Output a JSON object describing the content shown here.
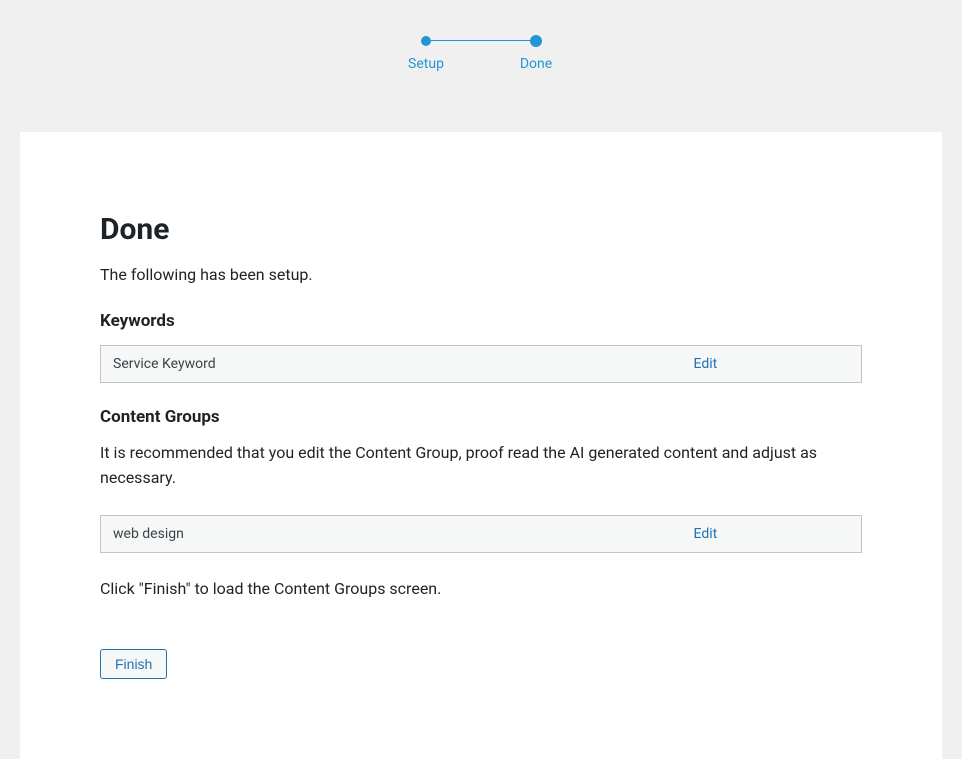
{
  "stepper": {
    "steps": [
      {
        "label": "Setup"
      },
      {
        "label": "Done"
      }
    ]
  },
  "page": {
    "title": "Done",
    "subtext": "The following has been setup."
  },
  "keywords": {
    "heading": "Keywords",
    "rows": [
      {
        "name": "Service Keyword",
        "edit_label": "Edit"
      }
    ]
  },
  "content_groups": {
    "heading": "Content Groups",
    "description": "It is recommended that you edit the Content Group, proof read the AI generated content and adjust as necessary.",
    "rows": [
      {
        "name": "web design",
        "edit_label": "Edit"
      }
    ]
  },
  "footer": {
    "finish_instruction": "Click \"Finish\" to load the Content Groups screen.",
    "finish_label": "Finish"
  }
}
